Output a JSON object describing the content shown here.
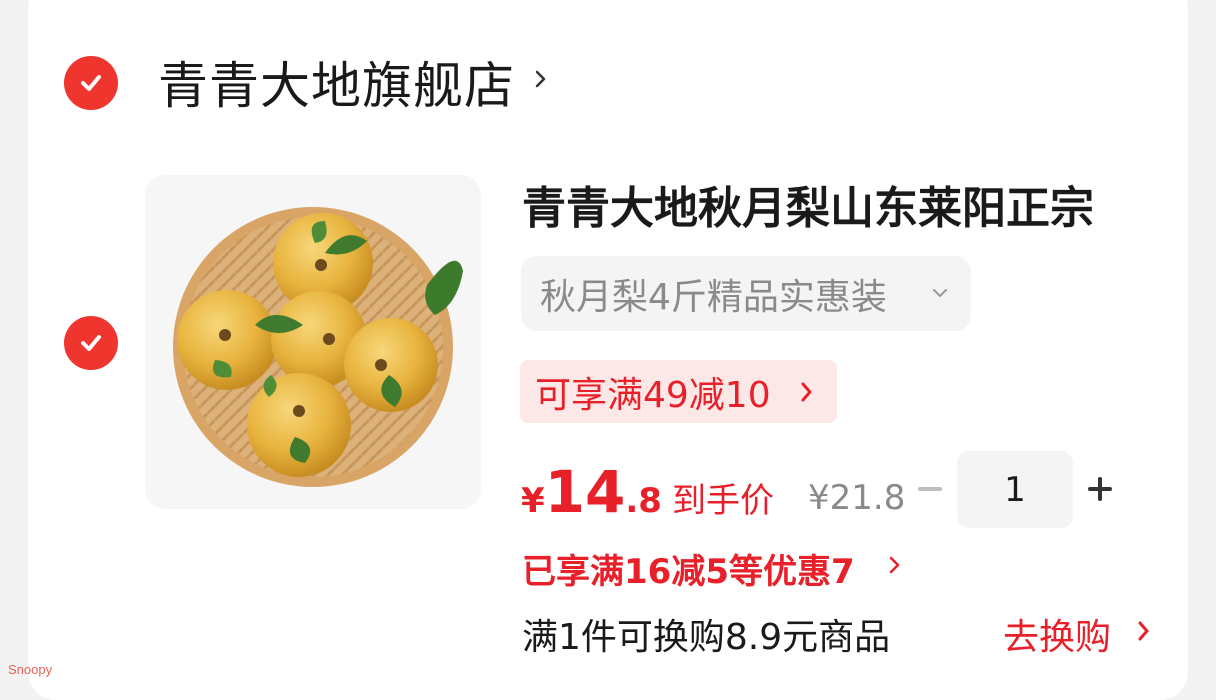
{
  "store": {
    "name": "青青大地旗舰店",
    "selected": true
  },
  "item": {
    "selected": true,
    "title": "青青大地秋月梨山东莱阳正宗",
    "spec": "秋月梨4斤精品实惠装",
    "promo": "可享满49减10",
    "price": {
      "currency": "¥",
      "integer": "14",
      "decimal": ".8",
      "label": "到手价"
    },
    "original_price": "¥21.8",
    "quantity": "1",
    "discount_info": "已享满16减5等优惠7",
    "swap_offer": "满1件可换购8.9元商品",
    "swap_button": "去换购"
  },
  "watermark": "Snoopy",
  "colors": {
    "accent": "#e8202a",
    "check": "#f0342e",
    "promo_bg": "#fde8e8"
  },
  "icons": [
    "check-icon",
    "chevron-right-icon",
    "chevron-down-icon",
    "minus-icon",
    "plus-icon"
  ]
}
